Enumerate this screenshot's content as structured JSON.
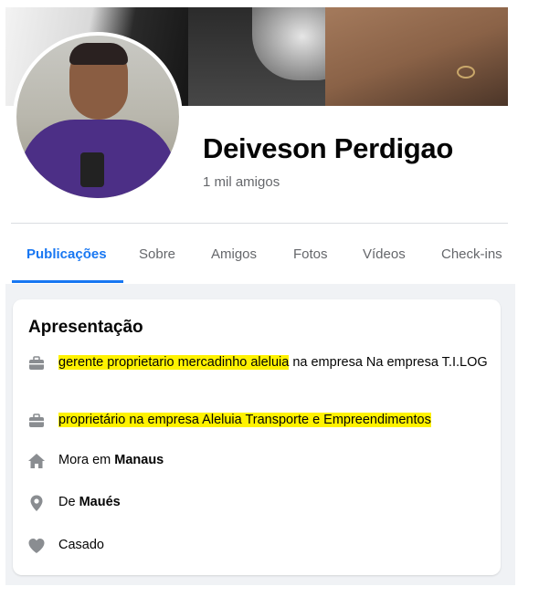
{
  "profile": {
    "name": "Deiveson Perdigao",
    "friends": "1 mil amigos"
  },
  "tabs": [
    {
      "label": "Publicações",
      "active": true
    },
    {
      "label": "Sobre"
    },
    {
      "label": "Amigos"
    },
    {
      "label": "Fotos"
    },
    {
      "label": "Vídeos"
    },
    {
      "label": "Check-ins"
    }
  ],
  "intro": {
    "title": "Apresentação",
    "work1": {
      "highlight": "gerente proprietario mercadinho aleluia",
      "rest": " na empresa Na empresa T.I.LOG",
      "icon": "briefcase-icon"
    },
    "work2": {
      "highlight": "proprietário na empresa Aleluia Transporte e Empreendimentos",
      "icon": "briefcase-icon"
    },
    "lives": {
      "prefix": "Mora em ",
      "place": "Manaus",
      "icon": "home-icon"
    },
    "from": {
      "prefix": "De ",
      "place": "Maués",
      "icon": "location-pin-icon"
    },
    "relationship": {
      "text": "Casado",
      "icon": "heart-icon"
    }
  },
  "colors": {
    "accent": "#1877f2",
    "highlight": "#fff200",
    "muted_text": "#65676b",
    "icon": "#8a8d91"
  }
}
